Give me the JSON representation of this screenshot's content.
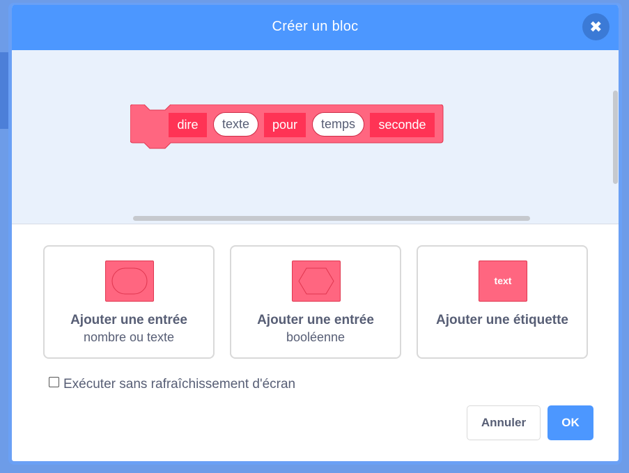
{
  "dialog": {
    "title": "Créer un bloc",
    "close_icon": "close-icon"
  },
  "block": {
    "color": "#ff6680",
    "label_color": "#ff3355",
    "parts": [
      {
        "kind": "label",
        "text": "dire"
      },
      {
        "kind": "input",
        "text": "texte"
      },
      {
        "kind": "label",
        "text": "pour"
      },
      {
        "kind": "input",
        "text": "temps"
      },
      {
        "kind": "label",
        "text": "seconde"
      }
    ]
  },
  "options": [
    {
      "title": "Ajouter une entrée",
      "subtitle": "nombre ou texte",
      "icon": "number-text-input-icon"
    },
    {
      "title": "Ajouter une entrée",
      "subtitle": "booléenne",
      "icon": "boolean-input-icon"
    },
    {
      "title": "Ajouter une étiquette",
      "subtitle": "",
      "icon": "label-icon",
      "icon_text": "text"
    }
  ],
  "checkbox": {
    "label": "Exécuter sans rafraîchissement d'écran",
    "checked": false
  },
  "buttons": {
    "cancel": "Annuler",
    "ok": "OK"
  },
  "colors": {
    "header": "#4c97ff",
    "accent": "#4c97ff",
    "text": "#575e75"
  }
}
